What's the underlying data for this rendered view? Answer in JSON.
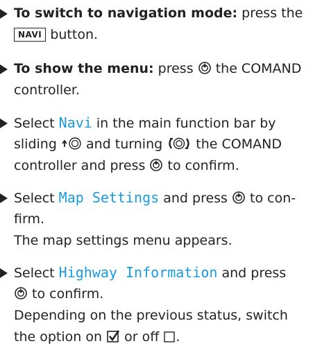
{
  "colors": {
    "text": "#222222",
    "keyword": "#1a9be0",
    "background": "#ffffff"
  },
  "icons": {
    "press": "press-controller-icon",
    "slide_up": "slide-up-controller-icon",
    "turn": "turn-controller-icon",
    "checked": "checkbox-checked-icon",
    "unchecked": "checkbox-unchecked-icon"
  },
  "steps": [
    {
      "lead": "To switch to navigation mode:",
      "text_after_lead": "press the",
      "key_label": "NAVI",
      "text_after_key": "button."
    },
    {
      "lead": "To show the menu:",
      "text_press": "press",
      "text_after_icon": "the COMAND",
      "line2": "controller."
    },
    {
      "select_word": "Select",
      "keyword": "Navi",
      "line1_rest": "in the main function bar by",
      "sliding": "sliding",
      "and_turning": "and turning",
      "the_comand": "the COMAND",
      "line3_start": "controller and press",
      "line3_end": "to confirm."
    },
    {
      "select_word": "Select",
      "keyword": "Map Settings",
      "and_press": "and press",
      "to_con": "to con-",
      "line2": "firm.",
      "result": "The map settings menu appears."
    },
    {
      "select_word": "Select",
      "keyword": "Highway Information",
      "and_press": "and press",
      "line2_end": "to confirm.",
      "result_line1": "Depending on the previous status, switch",
      "result_line2_start": "the option on",
      "result_line2_mid": "or off",
      "result_line2_end": "."
    }
  ]
}
